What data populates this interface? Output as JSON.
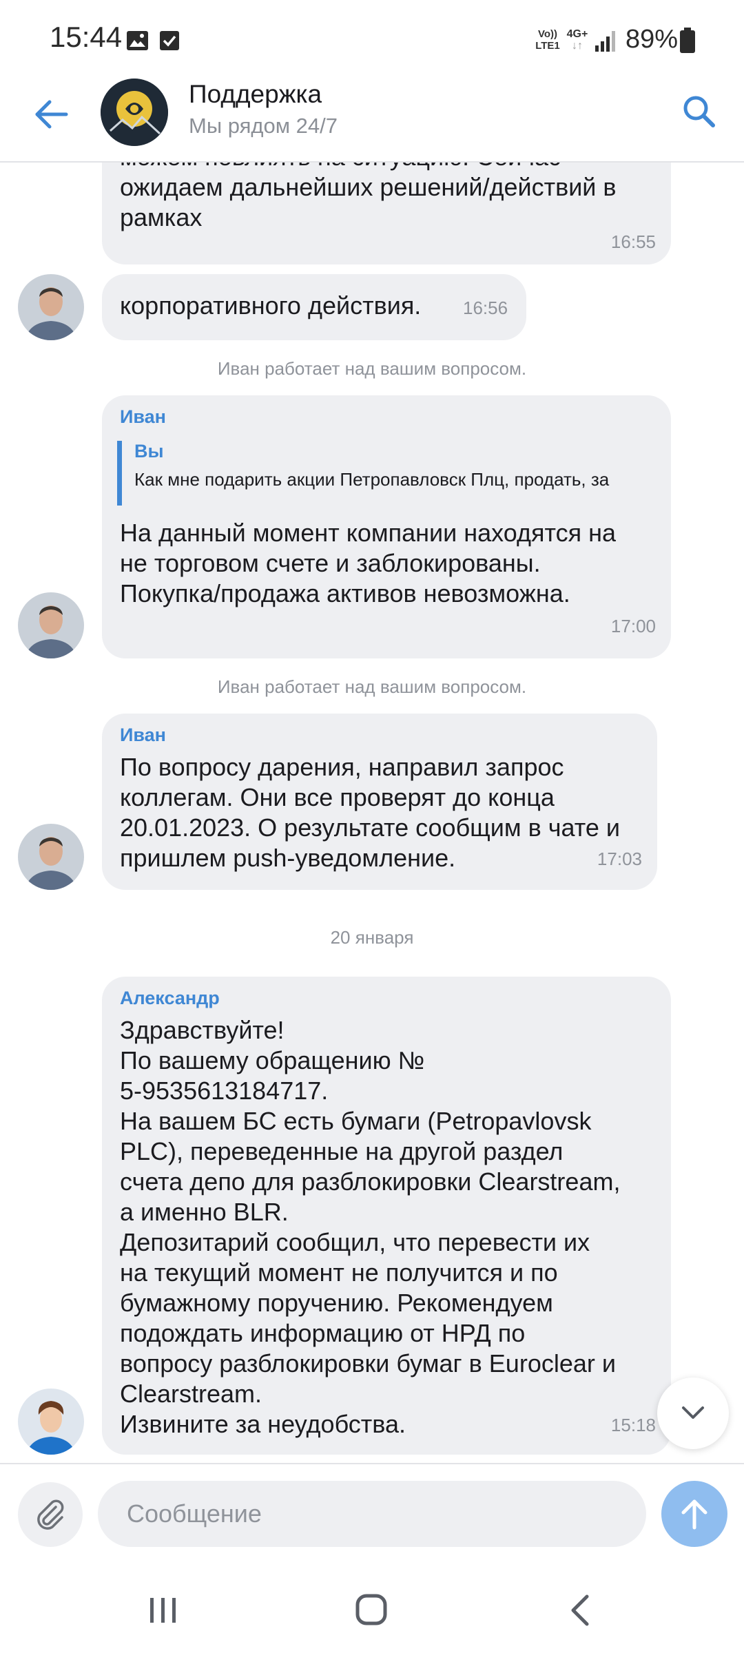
{
  "status_bar": {
    "time": "15:44",
    "volte_line1": "Vo))",
    "volte_line2": "LTE1",
    "network_line1": "4G+",
    "network_line2": "↓↑",
    "battery": "89%",
    "icons": [
      "image-icon",
      "checkbox-icon",
      "signal-icon",
      "battery-icon"
    ]
  },
  "header": {
    "title": "Поддержка",
    "subtitle": "Мы рядом 24/7",
    "icons": [
      "back-arrow-icon",
      "search-icon"
    ],
    "accent_color": "#3f87d4"
  },
  "messages": [
    {
      "id": "m1",
      "lines": [
        "можем повлиять на ситуацию. Сейчас",
        "ожидаем дальнейших решений/действий в",
        "рамках"
      ],
      "time": "16:55"
    },
    {
      "id": "m2",
      "lines": [
        "корпоративного действия."
      ],
      "time": "16:56"
    },
    {
      "id": "sys1",
      "system": "Иван работает над вашим вопросом."
    },
    {
      "id": "m3",
      "sender": "Иван",
      "quote_author": "Вы",
      "quote_text": "Как мне подарить акции Петропавловск Плц, продать, за",
      "lines": [
        "На данный момент компании находятся на",
        "не торговом счете и заблокированы.",
        "Покупка/продажа активов невозможна."
      ],
      "time": "17:00"
    },
    {
      "id": "sys2",
      "system": "Иван работает над вашим вопросом."
    },
    {
      "id": "m4",
      "sender": "Иван",
      "lines": [
        "По вопросу дарения, направил запрос",
        "коллегам. Они все проверят до конца",
        "20.01.2023. О результате сообщим в чате и",
        "пришлем push-уведомление."
      ],
      "time": "17:03"
    },
    {
      "id": "date1",
      "date": "20 января"
    },
    {
      "id": "m5",
      "sender": "Александр",
      "lines": [
        "Здравствуйте!",
        "По вашему обращению №",
        "5-9535613184717.",
        "На вашем БС есть бумаги (Petropavlovsk",
        "PLC), переведенные на другой раздел",
        "счета депо для разблокировки Clearstream,",
        "а именно BLR.",
        "Депозитарий сообщил, что перевести их",
        "на текущий момент не получится и по",
        "бумажному поручению. Рекомендуем",
        "подождать информацию от НРД по",
        "вопросу разблокировки бумаг в Euroclear и",
        "Clearstream.",
        "Извините за неудобства."
      ],
      "time": "15:18"
    }
  ],
  "input": {
    "placeholder": "Сообщение",
    "value": ""
  },
  "controls": {
    "attach_icon": "paperclip-icon",
    "send_icon": "arrow-up-icon",
    "scroll_icon": "chevron-down-icon",
    "send_color": "#8fbdef"
  },
  "nav": {
    "icons": [
      "recents-icon",
      "home-icon",
      "back-icon"
    ]
  }
}
